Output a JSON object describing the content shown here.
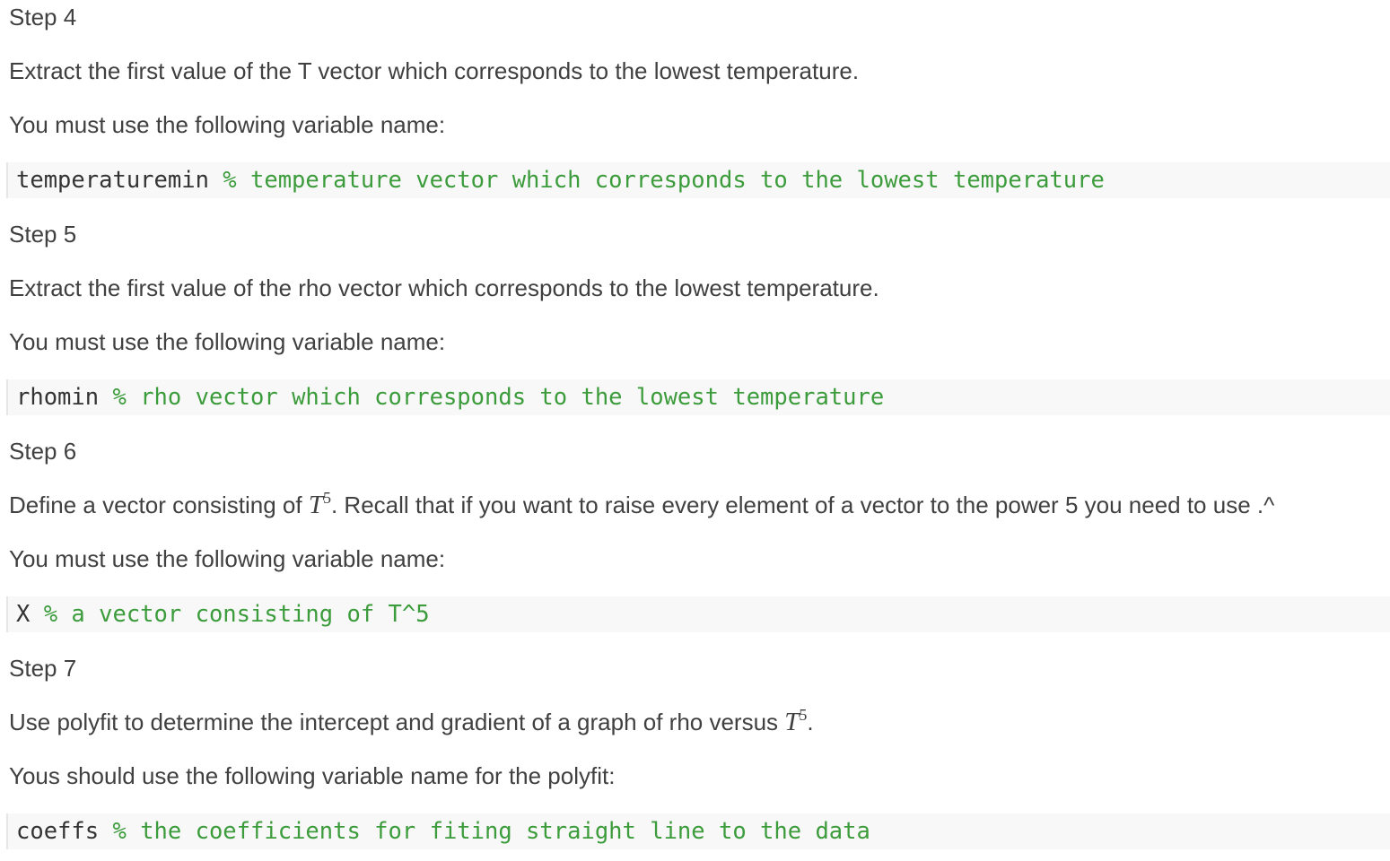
{
  "steps": [
    {
      "title": "Step 4",
      "instruction": "Extract the first value of the T vector which corresponds to the lowest temperature.",
      "variable_prompt": "You must use the following variable name:",
      "code": {
        "variable": "temperaturemin",
        "comment": "% temperature vector which corresponds to the lowest temperature"
      }
    },
    {
      "title": "Step 5",
      "instruction": "Extract the first value of the rho vector which corresponds to the lowest temperature.",
      "variable_prompt": "You must use the following variable name:",
      "code": {
        "variable": "rhomin",
        "comment": "% rho vector which corresponds to the lowest temperature"
      }
    },
    {
      "title": "Step 6",
      "instruction_before": "Define a vector consisting of ",
      "math_base": "T",
      "math_exponent": "5",
      "instruction_after": ". Recall that if you want to raise every element of a vector to the power 5 you need to use .^",
      "variable_prompt": "You must use the following variable name:",
      "code": {
        "variable": "X",
        "comment": "% a vector consisting of T^5"
      }
    },
    {
      "title": "Step 7",
      "instruction_before": "Use polyfit to determine the intercept and gradient of a graph of rho versus ",
      "math_base": "T",
      "math_exponent": "5",
      "instruction_after": ".",
      "variable_prompt": "Yous should use the following variable name for the polyfit:",
      "code": {
        "variable": "coeffs",
        "comment": "% the coefficients for fiting straight line to the data"
      }
    }
  ]
}
